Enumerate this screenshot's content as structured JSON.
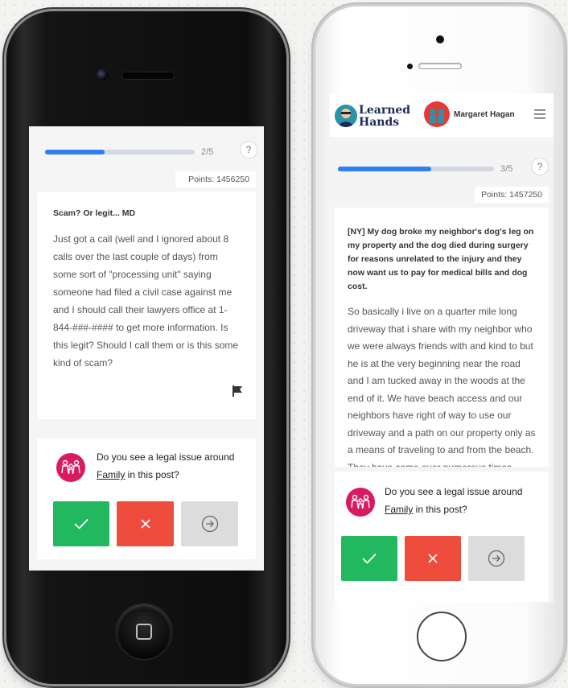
{
  "colors": {
    "progress": "#2f80ed",
    "yes": "#21b85f",
    "no": "#ee4d3d",
    "skip": "#dcdcdc",
    "issue": "#d81b60",
    "logo_text": "#1d2a57"
  },
  "left_phone": {
    "progress": {
      "fraction": 0.4,
      "label": "2/5"
    },
    "help_label": "?",
    "points": "Points: 1456250",
    "post": {
      "title": "Scam? Or legit... MD",
      "body": "Just got a call (well and I ignored about 8 calls over the last couple of days) from some sort of \"processing unit\" saying someone had filed a civil case against me and I should call their lawyers office at 1-844-###-#### to get more information. Is this legit? Should I call them or is this some kind of scam?"
    },
    "question": {
      "prefix": "Do you see a legal issue around",
      "topic": "Family",
      "suffix": " in this post?"
    },
    "icons": {
      "yes": "check-icon",
      "no": "close-icon",
      "skip": "arrow-right-circle-icon",
      "flag": "flag-icon",
      "issue": "family-icon"
    }
  },
  "right_phone": {
    "header": {
      "logo_line1": "Learned",
      "logo_line2": "Hands",
      "user_name": "Margaret Hagan",
      "menu_icon": "hamburger-menu-icon"
    },
    "progress": {
      "fraction": 0.6,
      "label": "3/5"
    },
    "help_label": "?",
    "points": "Points: 1457250",
    "post": {
      "title": "[NY] My dog broke my neighbor's dog's leg on my property and the dog died during surgery for reasons unrelated to the injury and they now want us to pay for medical bills and dog cost.",
      "body": "So basically i live on a quarter mile long driveway that i share with my neighbor who we were always friends with and kind to but he is at the very beginning near the road and I am tucked away in the woods at the end of it.  We have beach access and our neighbors have right of way to use our driveway and a path on our property only as a means of traveling to and from the beach. They have come over numerous times without warning"
    },
    "question": {
      "prefix": "Do you see a legal issue around",
      "topic": "Family",
      "suffix": " in this post?"
    },
    "icons": {
      "yes": "check-icon",
      "no": "close-icon",
      "skip": "arrow-right-circle-icon",
      "issue": "family-icon"
    }
  }
}
